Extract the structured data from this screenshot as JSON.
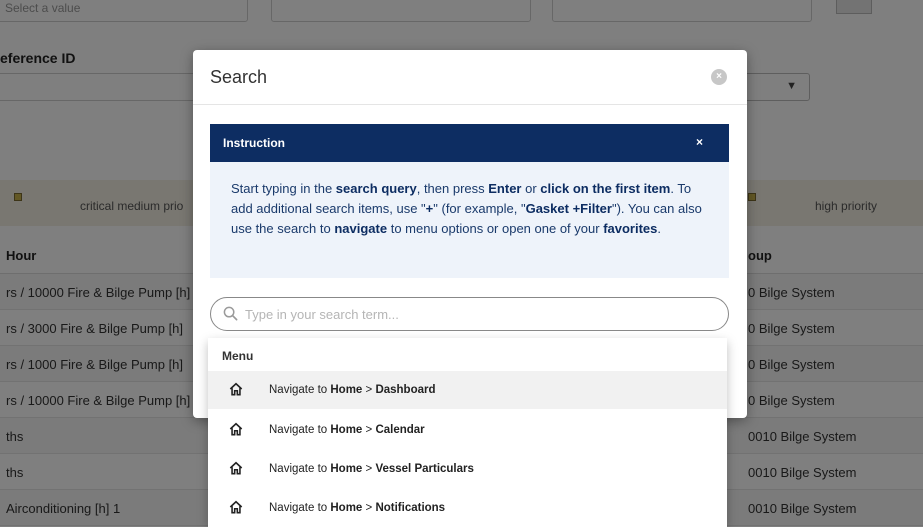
{
  "background": {
    "filter_input_1": "Select a value",
    "reference_label": "eference ID",
    "legend": {
      "item_1": "critical medium prio",
      "item_2": "high priority"
    },
    "table_headers": {
      "col_1": "Hour",
      "col_2": "oup"
    },
    "rows": [
      {
        "left": "rs / 10000 Fire & Bilge Pump [h]",
        "right": "0 Bilge System"
      },
      {
        "left": "rs / 3000 Fire & Bilge Pump [h]",
        "right": "0 Bilge System"
      },
      {
        "left": "rs / 1000 Fire & Bilge Pump [h]",
        "right": "0 Bilge System"
      },
      {
        "left": "rs / 10000 Fire & Bilge Pump [h]",
        "right": "0 Bilge System"
      },
      {
        "left": "ths",
        "right": "0010 Bilge System"
      },
      {
        "left": "ths",
        "right": "0010 Bilge System"
      },
      {
        "left": "Airconditioning [h] 1",
        "right": "0010 Bilge System"
      }
    ]
  },
  "modal": {
    "title": "Search",
    "close_symbol": "×"
  },
  "instruction": {
    "title": "Instruction",
    "close_symbol": "×",
    "t1": "Start typing in the ",
    "b1": "search query",
    "t2": ", then press ",
    "b2": "Enter",
    "t3": " or ",
    "b3": "click on the first item",
    "t4": ". To add additional search items, use \"",
    "b4": "+",
    "t5": "\" (for example, \"",
    "b5": "Gasket +Filter",
    "t6": "\"). You can also use the search to ",
    "b6": "navigate",
    "t7": " to menu options or open one of your ",
    "b7": "favorites",
    "t8": "."
  },
  "search": {
    "placeholder": "Type in your search term...",
    "value": ""
  },
  "dropdown": {
    "group_label": "Menu",
    "items": [
      {
        "prefix": "Navigate to ",
        "section": "Home",
        "sep": " > ",
        "target": "Dashboard",
        "icon": "home-icon"
      },
      {
        "prefix": "Navigate to ",
        "section": "Home",
        "sep": " > ",
        "target": "Calendar",
        "icon": "home-icon"
      },
      {
        "prefix": "Navigate to ",
        "section": "Home",
        "sep": " > ",
        "target": "Vessel Particulars",
        "icon": "home-icon"
      },
      {
        "prefix": "Navigate to ",
        "section": "Home",
        "sep": " > ",
        "target": "Notifications",
        "icon": "home-icon"
      }
    ]
  },
  "colors": {
    "instruction_header": "#0d2d62",
    "instruction_bg": "#eef3fa",
    "overlay": "rgba(0,0,0,0.5)"
  }
}
